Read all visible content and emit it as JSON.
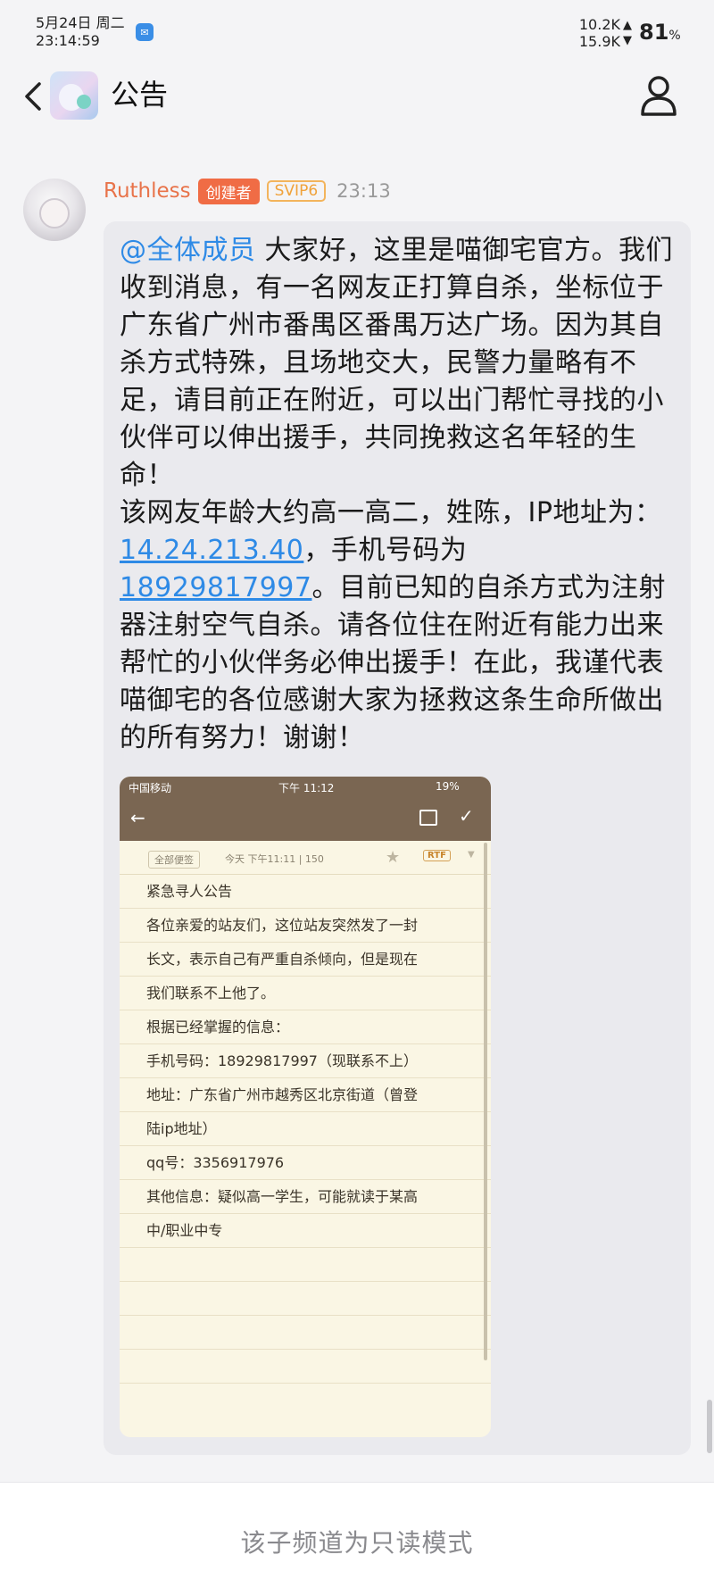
{
  "status_bar": {
    "date": "5月24日 周二",
    "time": "23:14:59",
    "upload": "10.2K",
    "download": "15.9K",
    "battery_value": "81",
    "battery_unit": "%"
  },
  "header": {
    "title": "公告"
  },
  "message": {
    "username": "Ruthless",
    "badge_creator": "创建者",
    "badge_vip": "SVIP6",
    "time": "23:13",
    "mention": "@全体成员",
    "text_1": " 大家好，这里是喵御宅官方。我们收到消息，有一名网友正打算自杀，坐标位于广东省广州市番禺区番禺万达广场。因为其自杀方式特殊，且场地交大，民警力量略有不足，请目前正在附近，可以出门帮忙寻找的小伙伴可以伸出援手，共同挽救这名年轻的生命！",
    "text_2": "该网友年龄大约高一高二，姓陈，IP地址为：",
    "ip": "14.24.213.40",
    "text_3": "，手机号码为",
    "phone": "18929817997",
    "text_4": "。目前已知的自杀方式为注射器注射空气自杀。请各位住在附近有能力出来帮忙的小伙伴务必伸出援手！在此，我谨代表喵御宅的各位感谢大家为拯救这条生命所做出的所有努力！谢谢！"
  },
  "attachment": {
    "status_carrier": "中国移动",
    "status_time": "下午 11:12",
    "status_battery": "19%",
    "note_tag": "全部便签",
    "note_date": "今天 下午11:11",
    "note_count": "150",
    "note_format": "RTF",
    "lines": [
      "紧急寻人公告",
      "各位亲爱的站友们，这位站友突然发了一封",
      "长文，表示自己有严重自杀倾向，但是现在",
      "我们联系不上他了。",
      "根据已经掌握的信息：",
      "手机号码：18929817997（现联系不上）",
      "地址：广东省广州市越秀区北京街道（曾登",
      "陆ip地址）",
      "qq号：3356917976",
      "其他信息：疑似高一学生，可能就读于某高",
      "中/职业中专",
      "",
      "",
      "",
      ""
    ]
  },
  "footer": {
    "readonly_text": "该子频道为只读模式"
  }
}
